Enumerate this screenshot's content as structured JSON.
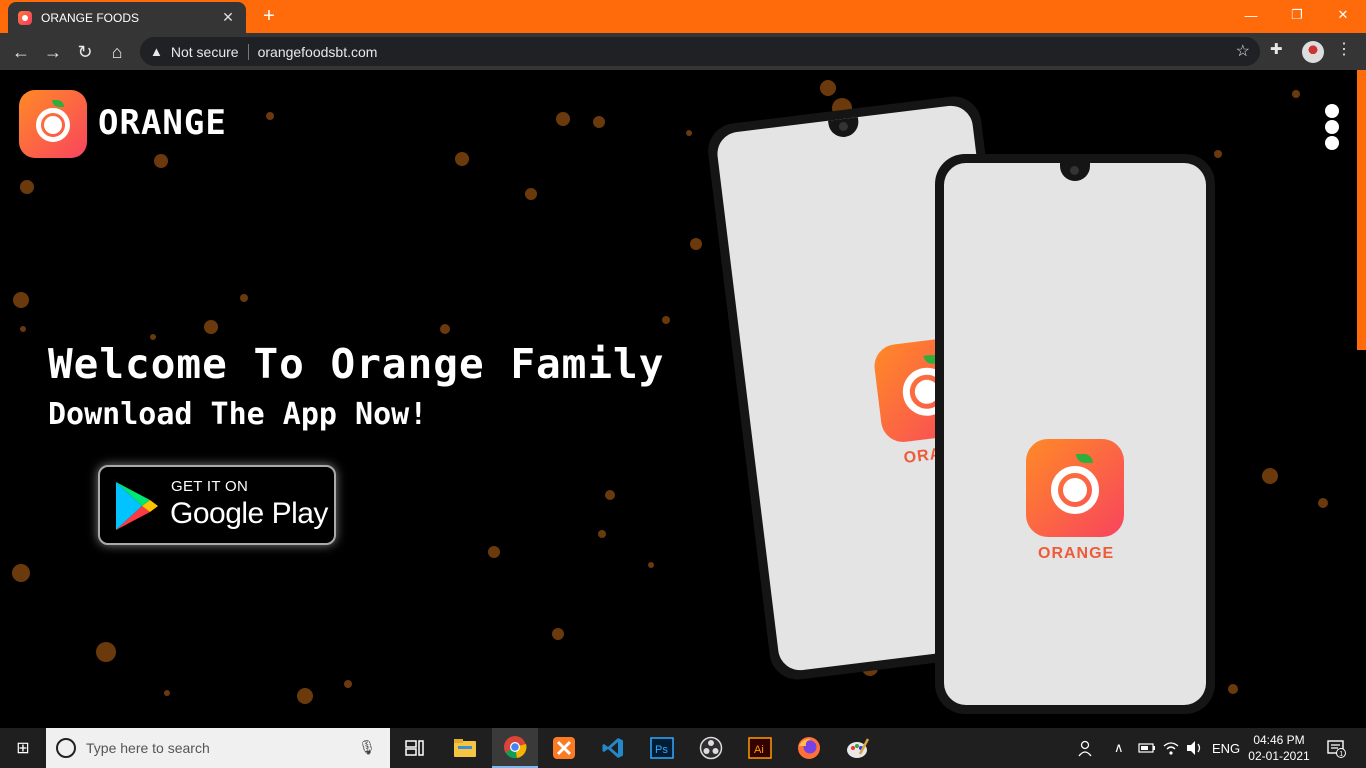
{
  "browser": {
    "tab_title": "ORANGE FOODS",
    "tab_close": "✕",
    "new_tab": "+",
    "window_controls": {
      "minimize": "—",
      "restore": "❐",
      "close": "✕"
    },
    "nav": {
      "back": "←",
      "forward": "→",
      "reload": "↻",
      "home": "⌂"
    },
    "security_label": "Not secure",
    "url": "orangefoodsbt.com",
    "accent_color": "#ff6a0b"
  },
  "site": {
    "brand": "ORANGE",
    "hero_title": "Welcome To Orange Family",
    "hero_subtitle": "Download The App Now!",
    "google_play": {
      "top": "GET IT ON",
      "main": "Google Play"
    },
    "phone_app_label": "ORANGE",
    "brand_gradient": [
      "#ff8a26",
      "#f8445e"
    ]
  },
  "taskbar": {
    "search_placeholder": "Type here to search",
    "apps": [
      "task-view",
      "file-explorer",
      "chrome",
      "xampp",
      "vscode",
      "photoshop",
      "obs",
      "illustrator",
      "firefox",
      "paint"
    ],
    "language": "ENG",
    "time": "04:46 PM",
    "date": "02-01-2021",
    "notification_count": "1"
  }
}
